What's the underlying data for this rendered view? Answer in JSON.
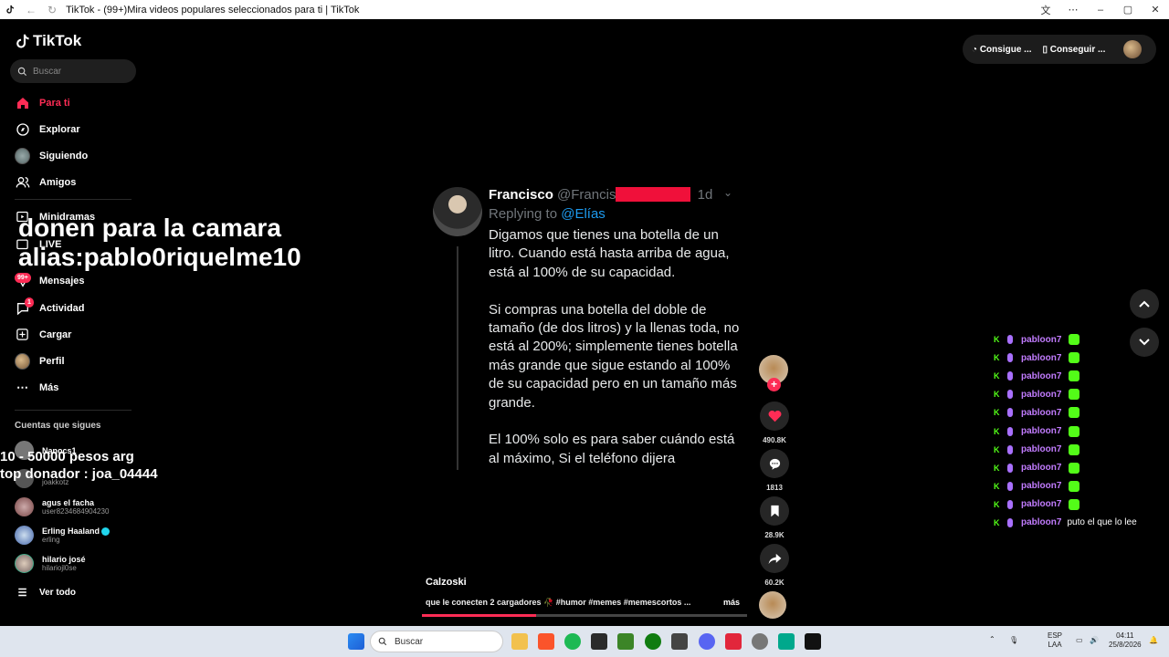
{
  "browser": {
    "title": "TikTok - (99+)Mira videos populares seleccionados para ti | TikTok"
  },
  "sidebar": {
    "logo": "TikTok",
    "search_placeholder": "Buscar",
    "items": [
      {
        "label": "Para ti",
        "icon": "home-icon",
        "active": true
      },
      {
        "label": "Explorar",
        "icon": "compass-icon"
      },
      {
        "label": "Siguiendo",
        "icon": "avatar"
      },
      {
        "label": "Amigos",
        "icon": "friends-icon"
      },
      {
        "label": "Minidramas",
        "icon": "film-icon"
      },
      {
        "label": "LIVE",
        "icon": "live-icon"
      },
      {
        "label": "Mensajes",
        "icon": "inbox-icon",
        "badge": "99+"
      },
      {
        "label": "Actividad",
        "icon": "activity-icon",
        "badge": "1"
      },
      {
        "label": "Cargar",
        "icon": "upload-icon"
      },
      {
        "label": "Perfil",
        "icon": "avatar"
      },
      {
        "label": "Más",
        "icon": "more-icon"
      }
    ],
    "following_title": "Cuentas que sigues",
    "following": [
      {
        "name": "Nanocs1",
        "user": ""
      },
      {
        "name": "",
        "user": "joakkotz"
      },
      {
        "name": "agus el facha",
        "user": "user8234684904230"
      },
      {
        "name": "Erling Haaland",
        "user": "erling",
        "verified": true
      },
      {
        "name": "hilario josé",
        "user": "hilariojl0se"
      }
    ],
    "see_all": "Ver todo"
  },
  "overlay": {
    "line1": "donen para la camara",
    "line2": "alias:pablo0riquelme10",
    "line3": "10 - 50000 pesos arg",
    "line4": "top donador : joa_04444"
  },
  "header": {
    "btn1": "Consigue ...",
    "btn2": "Conseguir ..."
  },
  "tweet": {
    "name": "Francisco",
    "handle": "@Francis",
    "time": "1d",
    "replying": "Replying to",
    "mention": "@Elías",
    "body": "Digamos que tienes una botella de un litro. Cuando está hasta arriba de agua, está al 100% de su capacidad.\n\nSi compras una botella del doble de tamaño (de dos litros) y la llenas toda, no está al 200%; simplemente tienes botella más grande que sigue estando al 100% de su capacidad pero en un tamaño más grande.\n\nEl 100% solo es para saber cuándo está al máximo, Si el teléfono dijera"
  },
  "actions": {
    "likes": "490.8K",
    "comments": "1813",
    "saves": "28.9K",
    "shares": "60.2K"
  },
  "caption": {
    "user": "Calzoski",
    "text": "que le conecten 2 cargadores 🥀 #humor #memes #memescortos ...",
    "more": "más",
    "progress": 0.35
  },
  "chat": [
    {
      "name": "pabloon7",
      "msg": ""
    },
    {
      "name": "pabloon7",
      "msg": ""
    },
    {
      "name": "pabloon7",
      "msg": ""
    },
    {
      "name": "pabloon7",
      "msg": ""
    },
    {
      "name": "pabloon7",
      "msg": ""
    },
    {
      "name": "pabloon7",
      "msg": ""
    },
    {
      "name": "pabloon7",
      "msg": ""
    },
    {
      "name": "pabloon7",
      "msg": ""
    },
    {
      "name": "pabloon7",
      "msg": ""
    },
    {
      "name": "pabloon7",
      "msg": ""
    },
    {
      "name": "pabloon7",
      "msg": "puto el que lo lee"
    }
  ],
  "taskbar": {
    "search": "Buscar",
    "lang1": "ESP",
    "lang2": "LAA",
    "time": "04:11",
    "date": "25/8/2026"
  },
  "colors": {
    "accent": "#fe2c55",
    "chat_name": "#c27cff",
    "kick_green": "#53fc18"
  }
}
